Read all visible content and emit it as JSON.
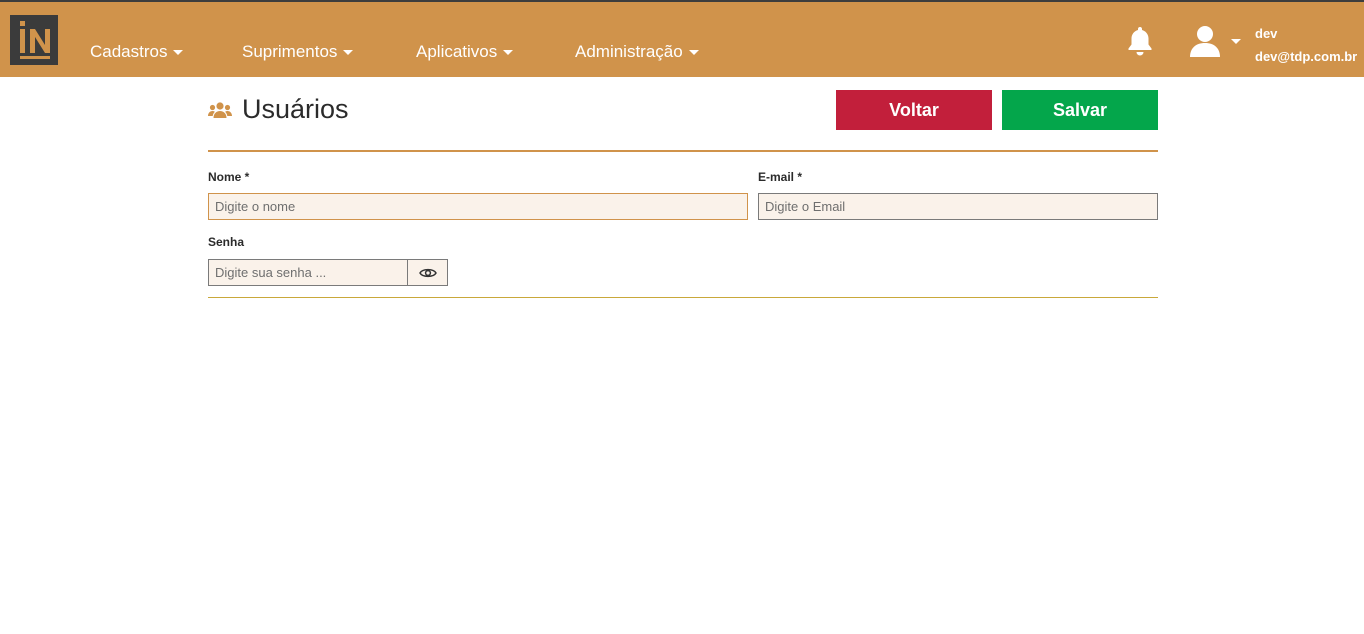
{
  "header": {
    "logo_alt": "IN",
    "nav": [
      {
        "label": "Cadastros"
      },
      {
        "label": "Suprimentos"
      },
      {
        "label": "Aplicativos"
      },
      {
        "label": "Administração"
      }
    ],
    "user": {
      "name": "dev",
      "email": "dev@tdp.com.br"
    },
    "icons": {
      "notifications": "bell-icon",
      "user": "user-icon",
      "user_menu": "chevron-down-icon"
    }
  },
  "page": {
    "title": "Usuários",
    "title_icon": "users-icon",
    "buttons": {
      "back": "Voltar",
      "save": "Salvar"
    }
  },
  "form": {
    "name": {
      "label": "Nome *",
      "value": "",
      "placeholder": "Digite o nome"
    },
    "email": {
      "label": "E-mail *",
      "value": "",
      "placeholder": "Digite o Email"
    },
    "password": {
      "label": "Senha",
      "value": "",
      "placeholder": "Digite sua senha ...",
      "toggle_icon": "eye-icon"
    }
  },
  "colors": {
    "header_bg": "#d0934b",
    "back_button": "#c21f3b",
    "save_button": "#04a64b",
    "input_bg": "#faf2ea"
  }
}
